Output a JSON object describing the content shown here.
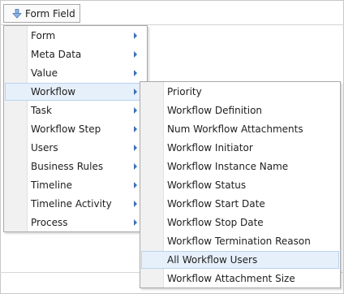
{
  "toolbar": {
    "field_button_label": "Form Field",
    "field_button_icon": "down-arrow-icon"
  },
  "main_menu": {
    "items": [
      {
        "label": "Form",
        "has_submenu": true
      },
      {
        "label": "Meta Data",
        "has_submenu": true
      },
      {
        "label": "Value",
        "has_submenu": true
      },
      {
        "label": "Workflow",
        "has_submenu": true,
        "highlighted": true
      },
      {
        "label": "Task",
        "has_submenu": true
      },
      {
        "label": "Workflow Step",
        "has_submenu": true
      },
      {
        "label": "Users",
        "has_submenu": true
      },
      {
        "label": "Business Rules",
        "has_submenu": true
      },
      {
        "label": "Timeline",
        "has_submenu": true
      },
      {
        "label": "Timeline Activity",
        "has_submenu": true
      },
      {
        "label": "Process",
        "has_submenu": true
      }
    ]
  },
  "workflow_submenu": {
    "items": [
      {
        "label": "Priority"
      },
      {
        "label": "Workflow Definition"
      },
      {
        "label": "Num Workflow Attachments"
      },
      {
        "label": "Workflow Initiator"
      },
      {
        "label": "Workflow Instance Name"
      },
      {
        "label": "Workflow Status"
      },
      {
        "label": "Workflow Start Date"
      },
      {
        "label": "Workflow Stop Date"
      },
      {
        "label": "Workflow Termination Reason"
      },
      {
        "label": "All Workflow Users",
        "highlighted": true
      },
      {
        "label": "Workflow Attachment Size"
      }
    ]
  },
  "colors": {
    "highlight_fill": "#e6f0fb",
    "highlight_border": "#b9d3f0",
    "arrow": "#3d6fb4",
    "gutter": "#f1f1f1"
  }
}
